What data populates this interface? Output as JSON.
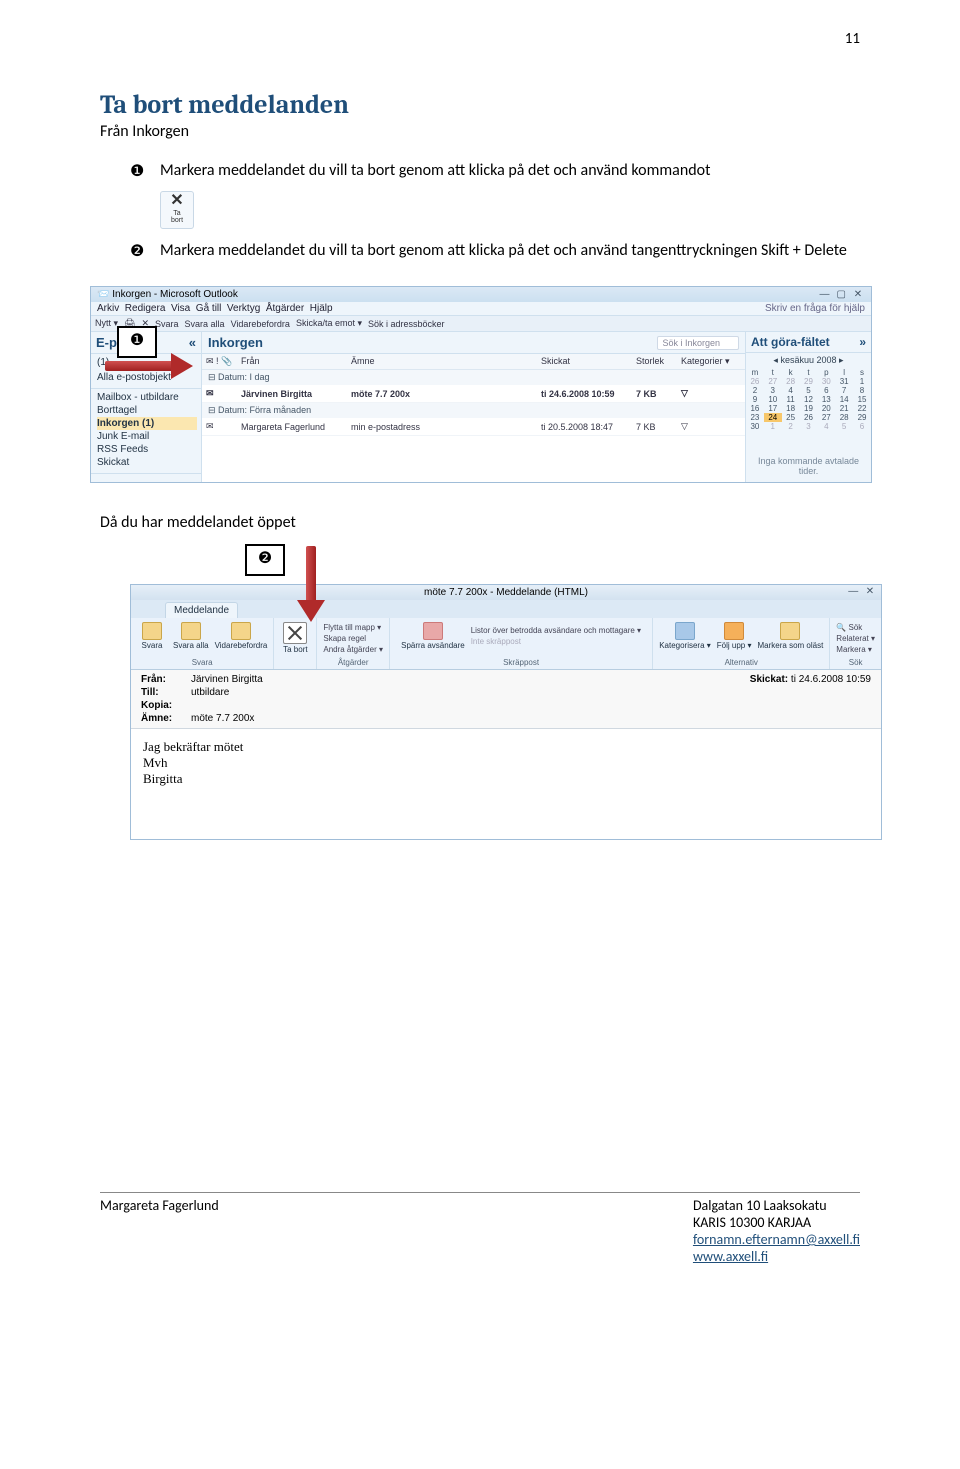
{
  "page_number": "11",
  "title": "Ta bort meddelanden",
  "subtitle": "Från Inkorgen",
  "steps": {
    "one_num": "❶",
    "one_text": "Markera meddelandet du vill ta bort genom att klicka på det och använd kommandot",
    "two_num": "❷",
    "two_text": "Markera meddelandet du vill ta bort genom att klicka på det och använd tangenttryckningen Skift + Delete"
  },
  "ta_bort_icon": {
    "x": "✕",
    "l1": "Ta",
    "l2": "bort"
  },
  "section2_label": "Då du har meddelandet öppet",
  "outlook": {
    "title": "Inkorgen - Microsoft Outlook",
    "menu": [
      "Arkiv",
      "Redigera",
      "Visa",
      "Gå till",
      "Verktyg",
      "Åtgärder",
      "Hjälp"
    ],
    "menu_right": "Skriv en fråga för hjälp",
    "toolbar": [
      "Nytt ▾",
      "✉",
      "✕",
      "Svara",
      "Svara alla",
      "Vidarebefordra",
      "Skicka/ta emot ▾",
      "Sök i adressböcker"
    ],
    "nav_header": "E-post",
    "nav_chevron": "«",
    "nav_items": [
      "(1)",
      "",
      "Alla e-postobjekt"
    ],
    "nav_items2": [
      "Mailbox - utbildare",
      "Borttagel",
      "Inkorgen (1)",
      "Junk E-mail",
      "RSS Feeds",
      "Skickat"
    ],
    "inbox_header": "Inkorgen",
    "search_placeholder": "Sök i Inkorgen",
    "cols": [
      "✉ ! 📎",
      "Från",
      "Ämne",
      "Skickat",
      "Storlek",
      "Kategorier ▾"
    ],
    "group1": "⊟ Datum: I dag",
    "row1": {
      "from": "Järvinen Birgitta",
      "subj": "möte 7.7 200x",
      "sent": "ti 24.6.2008 10:59",
      "size": "7 KB"
    },
    "group2": "⊟ Datum: Förra månaden",
    "row2": {
      "from": "Margareta Fagerlund",
      "subj": "min e-postadress",
      "sent": "ti 20.5.2008 18:47",
      "size": "7 KB"
    },
    "todo_header": "Att göra-fältet",
    "todo_chevron": "»",
    "month_prev": "◂",
    "month": "kesäkuu 2008",
    "month_next": "▸",
    "dow": [
      "m",
      "t",
      "k",
      "t",
      "p",
      "l",
      "s"
    ],
    "calendar": [
      [
        "26",
        "27",
        "28",
        "29",
        "30",
        "31",
        "1"
      ],
      [
        "2",
        "3",
        "4",
        "5",
        "6",
        "7",
        "8"
      ],
      [
        "9",
        "10",
        "11",
        "12",
        "13",
        "14",
        "15"
      ],
      [
        "16",
        "17",
        "18",
        "19",
        "20",
        "21",
        "22"
      ],
      [
        "23",
        "24",
        "25",
        "26",
        "27",
        "28",
        "29"
      ],
      [
        "30",
        "1",
        "2",
        "3",
        "4",
        "5",
        "6"
      ]
    ],
    "today_row": 4,
    "today_col": 1,
    "todo_note": "Inga kommande avtalade tider."
  },
  "callout1": "❶",
  "callout2": "❷",
  "msg": {
    "title": "möte 7.7 200x - Meddelande (HTML)",
    "tab": "Meddelande",
    "ribbon": {
      "svara": {
        "items": [
          "Svara",
          "Svara alla",
          "Vidarebefordra"
        ],
        "label": "Svara"
      },
      "bort": "Ta bort",
      "atg": {
        "items": [
          "Flytta till mapp ▾",
          "Skapa regel",
          "Andra åtgärder ▾"
        ],
        "label": "Åtgärder"
      },
      "skrap": {
        "b1": "Spärra avsändare",
        "b2": "Listor över betrodda avsändare och mottagare ▾",
        "b3": "Inte skräppost",
        "label": "Skräppost"
      },
      "alt": {
        "items": [
          "Kategorisera ▾",
          "Följ upp ▾",
          "Markera som oläst"
        ],
        "label": "Alternativ"
      },
      "sok": {
        "items": [
          "Sök",
          "Relaterat ▾",
          "Markera ▾"
        ],
        "label": "Sök"
      }
    },
    "hdr": {
      "from_l": "Från:",
      "from": "Järvinen Birgitta",
      "to_l": "Till:",
      "to": "utbildare",
      "cc_l": "Kopia:",
      "subj_l": "Ämne:",
      "subj": "möte 7.7 200x",
      "sent_l": "Skickat:",
      "sent": "ti 24.6.2008 10:59"
    },
    "body": [
      "Jag bekräftar mötet",
      "Mvh",
      "Birgitta"
    ]
  },
  "footer": {
    "author": "Margareta Fagerlund",
    "addr1": "Dalgatan 10 Laaksokatu",
    "addr2": "KARIS 10300  KARJAA",
    "email": "fornamn.efternamn@axxell.fi",
    "web": "www.axxell.fi"
  }
}
